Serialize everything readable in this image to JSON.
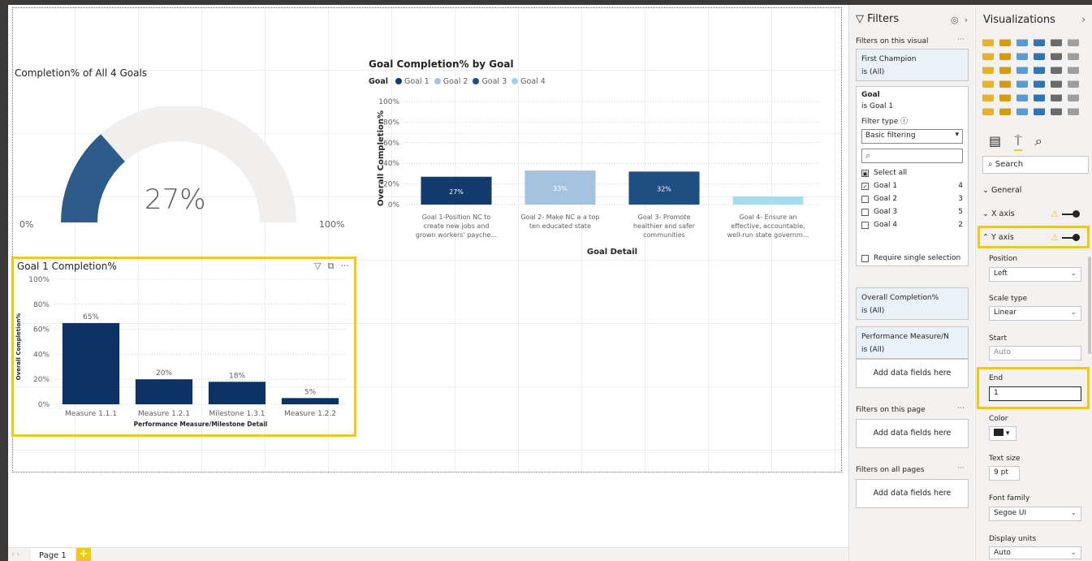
{
  "canvas": {
    "gauge": {
      "title": "Completion% of All 4 Goals",
      "value": 27,
      "value_label": "27%",
      "min_label": "0%",
      "max_label": "100%",
      "fill_color": "#2e5c8a",
      "track_color": "#f0efee"
    },
    "goal_chart": {
      "title": "Goal Completion% by Goal",
      "legend_label": "Goal",
      "legend": [
        {
          "name": "Goal 1",
          "color": "#123b6d"
        },
        {
          "name": "Goal 2",
          "color": "#a5c3df"
        },
        {
          "name": "Goal 3",
          "color": "#1f4e83"
        },
        {
          "name": "Goal 4",
          "color": "#9fd3e8"
        }
      ],
      "xlabel": "Goal Detail",
      "ylabel": "Overall Completion%"
    },
    "goal1_chart": {
      "title": "Goal 1 Completion%",
      "xlabel": "Performance Measure/Milestone Detail",
      "ylabel": "Overall Completion%",
      "icons": [
        "filter-icon",
        "focus-mode-icon",
        "more-options-icon"
      ]
    }
  },
  "chart_data": [
    {
      "type": "bar",
      "title": "Goal Completion% by Goal",
      "xlabel": "Goal Detail",
      "ylabel": "Overall Completion%",
      "yticks": [
        "0%",
        "20%",
        "40%",
        "60%",
        "80%",
        "100%"
      ],
      "ylim": [
        0,
        100
      ],
      "categories": [
        [
          "Goal 1-Position NC to",
          "create new jobs and",
          "grown workers' payche..."
        ],
        [
          "Goal 2- Make NC a a top",
          "ten educated state"
        ],
        [
          "Goal 3- Promote",
          "healthier and safer",
          "communities"
        ],
        [
          "Goal 4- Ensure an",
          "effective, accountable,",
          "well-run state governm..."
        ]
      ],
      "values": [
        27,
        33,
        32,
        8
      ],
      "data_labels": [
        "27%",
        "33%",
        "32%",
        ""
      ],
      "colors": [
        "#123b6d",
        "#a5c3df",
        "#1f4e83",
        "#a9dbef"
      ]
    },
    {
      "type": "bar",
      "title": "Goal 1 Completion%",
      "xlabel": "Performance Measure/Milestone Detail",
      "ylabel": "Overall Completion%",
      "yticks": [
        "0%",
        "20%",
        "40%",
        "60%",
        "80%",
        "100%"
      ],
      "ylim": [
        0,
        100
      ],
      "categories": [
        "Measure 1.1.1",
        "Measure 1.2.1",
        "Milestone 1.3.1",
        "Measure 1.2.2"
      ],
      "values": [
        65,
        20,
        18,
        5
      ],
      "data_labels": [
        "65%",
        "20%",
        "18%",
        "5%"
      ],
      "color": "#0e3263"
    }
  ],
  "tabs": {
    "page_label": "Page 1",
    "add_label": "+"
  },
  "filters": {
    "title": "Filters",
    "on_visual_label": "Filters on this visual",
    "first_champion": {
      "name": "First Champion",
      "value": "is (All)"
    },
    "goal": {
      "name": "Goal",
      "value": "is Goal 1",
      "filter_type_label": "Filter type ⓘ",
      "filter_type_value": "Basic filtering",
      "items": [
        {
          "label": "Select all",
          "count": "",
          "checked": "▣"
        },
        {
          "label": "Goal 1",
          "count": "4",
          "checked": "✓"
        },
        {
          "label": "Goal 2",
          "count": "3",
          "checked": ""
        },
        {
          "label": "Goal 3",
          "count": "5",
          "checked": ""
        },
        {
          "label": "Goal 4",
          "count": "2",
          "checked": ""
        }
      ],
      "require_single": "Require single selection"
    },
    "overall_completion": {
      "name": "Overall Completion%",
      "value": "is (All)"
    },
    "performance_measure": {
      "name": "Performance Measure/N",
      "value": "is (All)"
    },
    "add_fields": "Add data fields here",
    "on_page_label": "Filters on this page",
    "on_all_pages_label": "Filters on all pages",
    "more": "···"
  },
  "visualizations": {
    "title": "Visualizations",
    "search_placeholder": "Search",
    "sections": {
      "general": "General",
      "x_axis": "X axis",
      "y_axis": "Y axis"
    },
    "fields": {
      "position_label": "Position",
      "position_value": "Left",
      "scale_label": "Scale type",
      "scale_value": "Linear",
      "start_label": "Start",
      "start_value": "Auto",
      "end_label": "End",
      "end_value": "1",
      "color_label": "Color",
      "text_size_label": "Text size",
      "text_size_value": "9",
      "text_size_unit": "pt",
      "font_family_label": "Font family",
      "font_family_value": "Segoe UI",
      "display_units_label": "Display units",
      "display_units_value": "Auto"
    }
  }
}
